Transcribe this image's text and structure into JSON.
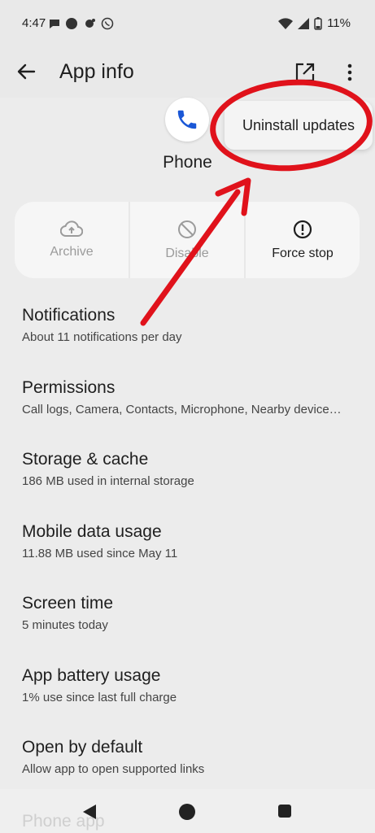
{
  "status_bar": {
    "time": "4:47",
    "battery": "11%"
  },
  "top_bar": {
    "title": "App info"
  },
  "app": {
    "name": "Phone"
  },
  "menu": {
    "uninstall_updates": "Uninstall updates"
  },
  "actions": [
    {
      "label": "Archive"
    },
    {
      "label": "Disable"
    },
    {
      "label": "Force stop"
    }
  ],
  "list": [
    {
      "title": "Notifications",
      "subtitle": "About 11 notifications per day"
    },
    {
      "title": "Permissions",
      "subtitle": "Call logs, Camera, Contacts, Microphone, Nearby device…"
    },
    {
      "title": "Storage & cache",
      "subtitle": "186 MB used in internal storage"
    },
    {
      "title": "Mobile data usage",
      "subtitle": "11.88 MB used since May 11"
    },
    {
      "title": "Screen time",
      "subtitle": "5 minutes today"
    },
    {
      "title": "App battery usage",
      "subtitle": "1% use since last full charge"
    },
    {
      "title": "Open by default",
      "subtitle": "Allow app to open supported links"
    }
  ],
  "peek": {
    "title": "Phone app"
  },
  "colors": {
    "annotation_red": "#e0121b",
    "phone_blue": "#1a57d6"
  }
}
